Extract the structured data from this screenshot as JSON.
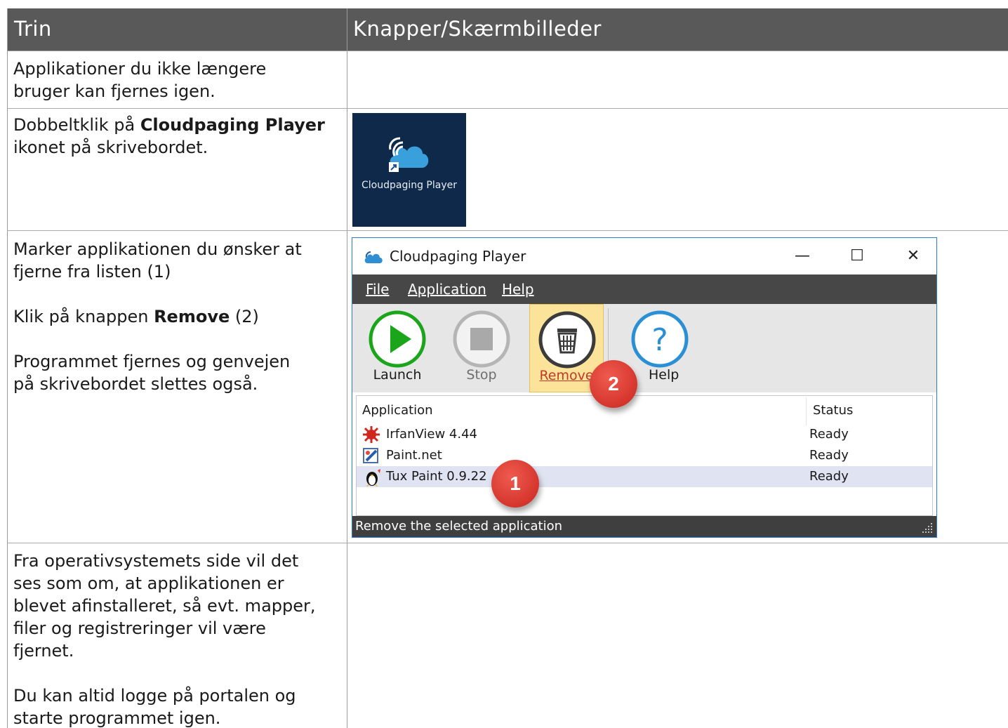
{
  "table": {
    "header": {
      "col1": "Trin",
      "col2": "Knapper/Skærmbilleder"
    },
    "rows": [
      {
        "text": "Applikationer du ikke længere bruger kan fjernes igen.",
        "lines": [
          "Applikationer du ikke længere",
          "bruger kan fjernes igen."
        ]
      },
      {
        "line1_pre": "Dobbeltklik på ",
        "line1_bold": "Cloudpaging Player",
        "line2": "ikonet på skrivebordet."
      },
      {
        "p1": [
          "Marker applikationen du ønsker at",
          "fjerne fra listen (1)"
        ],
        "p2_pre": "Klik på knappen ",
        "p2_bold": "Remove",
        "p2_post": " (2)",
        "p3": [
          "Programmet fjernes og genvejen",
          "på skrivebordet slettes også."
        ]
      },
      {
        "p1": [
          "Fra operativsystemets side vil det",
          "ses som om, at applikationen er",
          "blevet afinstalleret, så evt. mapper,",
          "filer og registreringer vil være",
          "fjernet."
        ],
        "p2": [
          "Du kan altid logge på portalen og",
          "starte programmet igen."
        ]
      }
    ]
  },
  "desktop_icon": {
    "label": "Cloudpaging Player"
  },
  "window": {
    "title": "Cloudpaging Player",
    "controls": {
      "minimize": "—",
      "maximize": "☐",
      "close": "✕"
    },
    "menu": [
      "File",
      "Application",
      "Help"
    ],
    "toolbar": [
      "Launch",
      "Stop",
      "Remove",
      "Help"
    ],
    "columns": {
      "application": "Application",
      "status": "Status"
    },
    "apps": [
      {
        "name": "IrfanView 4.44",
        "status": "Ready"
      },
      {
        "name": "Paint.net",
        "status": "Ready"
      },
      {
        "name": "Tux Paint 0.9.22",
        "status": "Ready",
        "selected": true
      }
    ],
    "statusbar": "Remove the selected application",
    "callouts": [
      "1",
      "2"
    ],
    "colors": {
      "menubar": "#474747",
      "toolbar": "#e6e6e6",
      "active_button": "#fbe39a",
      "badge": "#d9342b",
      "launch": "#1aa51a",
      "help": "#2b8fd6"
    }
  }
}
